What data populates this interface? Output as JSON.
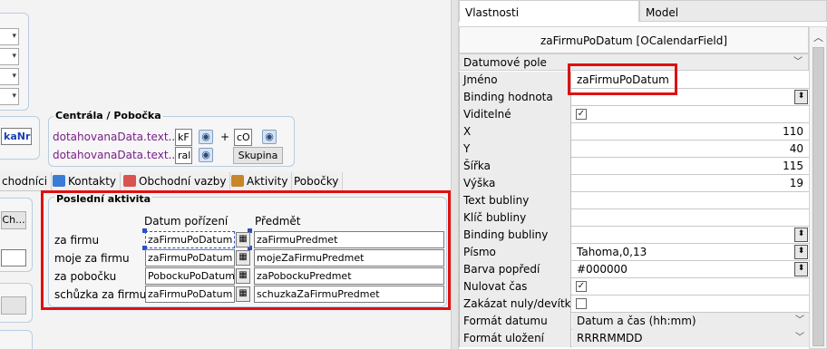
{
  "designer": {
    "group_centrala": {
      "title": "Centrála / Pobočka",
      "rows": [
        {
          "field": "dotahovanaData.text...",
          "code": "kF",
          "sign": "+",
          "code2": "cO"
        },
        {
          "field": "dotahovanaData.text...",
          "code": "ral",
          "button": "Skupina"
        }
      ],
      "left_label": "kaNr"
    },
    "tabs": [
      {
        "label": "chodníci",
        "icon": ""
      },
      {
        "label": "Kontakty",
        "icon": "contacts-icon"
      },
      {
        "label": "Obchodní vazby",
        "icon": "relations-icon"
      },
      {
        "label": "Aktivity",
        "icon": "activities-icon"
      },
      {
        "label": "Pobočky",
        "icon": ""
      }
    ],
    "ch_button": "Ch...",
    "activity": {
      "title": "Poslední aktivita",
      "col_date": "Datum pořízení",
      "col_subject": "Předmět",
      "rows": [
        {
          "label": "za firmu",
          "date": "zaFirmuPoDatum",
          "subject": "zaFirmuPredmet"
        },
        {
          "label": "moje za firmu",
          "date": "zaFirmuPoDatum",
          "subject": "mojeZaFirmuPredmet"
        },
        {
          "label": "za pobočku",
          "date": "PobockuPoDatum",
          "subject": "zaPobockuPredmet"
        },
        {
          "label": "schůzka za firmu",
          "date": "zaFirmuPoDatum",
          "subject": "schuzkaZaFirmuPredmet"
        }
      ]
    }
  },
  "properties": {
    "tabs": [
      "Vlastnosti",
      "Model"
    ],
    "title": "zaFirmuPoDatum [OCalendarField]",
    "category": "Datumové pole",
    "rows": [
      {
        "key": "Jméno",
        "value": "zaFirmuPoDatum",
        "kind": "text"
      },
      {
        "key": "Binding hodnota",
        "value": "",
        "kind": "picker"
      },
      {
        "key": "Viditelné",
        "value": "✓",
        "kind": "check"
      },
      {
        "key": "X",
        "value": "110",
        "kind": "num"
      },
      {
        "key": "Y",
        "value": "40",
        "kind": "num"
      },
      {
        "key": "Šířka",
        "value": "115",
        "kind": "num"
      },
      {
        "key": "Výška",
        "value": "19",
        "kind": "num"
      },
      {
        "key": "Text bubliny",
        "value": "",
        "kind": "text"
      },
      {
        "key": "Klíč bubliny",
        "value": "",
        "kind": "text"
      },
      {
        "key": "Binding bubliny",
        "value": "",
        "kind": "picker"
      },
      {
        "key": "Písmo",
        "value": "Tahoma,0,13",
        "kind": "picker"
      },
      {
        "key": "Barva popředí",
        "value": "#000000",
        "kind": "picker"
      },
      {
        "key": "Nulovat čas",
        "value": "✓",
        "kind": "check"
      },
      {
        "key": "Zakázat nuly/devítky",
        "value": "",
        "kind": "check"
      },
      {
        "key": "Formát datumu",
        "value": "Datum a čas (hh:mm)",
        "kind": "dropdown"
      },
      {
        "key": "Formát uložení",
        "value": "RRRRMMDD",
        "kind": "dropdown"
      }
    ]
  },
  "colors": {
    "highlight": "#e01010",
    "field_text": "#7a1f8b"
  }
}
